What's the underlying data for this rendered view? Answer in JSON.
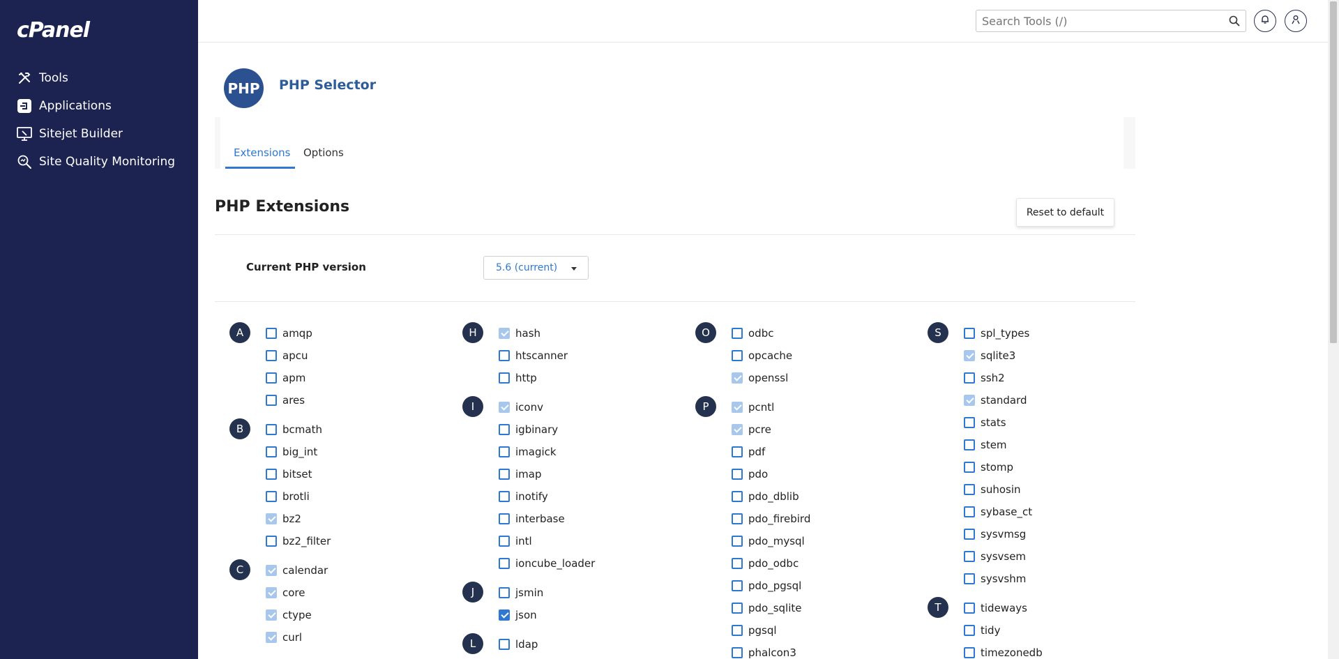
{
  "sidebar": {
    "logo": "cPanel",
    "items": [
      {
        "label": "Tools",
        "icon": "tools-icon"
      },
      {
        "label": "Applications",
        "icon": "applications-icon"
      },
      {
        "label": "Sitejet Builder",
        "icon": "sitejet-builder-icon"
      },
      {
        "label": "Site Quality Monitoring",
        "icon": "site-quality-monitoring-icon"
      }
    ]
  },
  "topbar": {
    "search_placeholder": "Search Tools (/)"
  },
  "header": {
    "logo_text": "PHP",
    "title": "PHP Selector"
  },
  "tabs": [
    {
      "label": "Extensions",
      "active": true
    },
    {
      "label": "Options",
      "active": false
    }
  ],
  "section": {
    "title": "PHP Extensions",
    "reset_label": "Reset to default",
    "version_label": "Current PHP version",
    "version_value": "5.6 (current)"
  },
  "extensions": {
    "columns": [
      {
        "groups": [
          {
            "letter": "A",
            "items": [
              {
                "name": "amqp",
                "checked": false,
                "disabled": false
              },
              {
                "name": "apcu",
                "checked": false,
                "disabled": false
              },
              {
                "name": "apm",
                "checked": false,
                "disabled": false
              },
              {
                "name": "ares",
                "checked": false,
                "disabled": false
              }
            ]
          },
          {
            "letter": "B",
            "items": [
              {
                "name": "bcmath",
                "checked": false,
                "disabled": false
              },
              {
                "name": "big_int",
                "checked": false,
                "disabled": false
              },
              {
                "name": "bitset",
                "checked": false,
                "disabled": false
              },
              {
                "name": "brotli",
                "checked": false,
                "disabled": false
              },
              {
                "name": "bz2",
                "checked": true,
                "disabled": true
              },
              {
                "name": "bz2_filter",
                "checked": false,
                "disabled": false
              }
            ]
          },
          {
            "letter": "C",
            "items": [
              {
                "name": "calendar",
                "checked": true,
                "disabled": true
              },
              {
                "name": "core",
                "checked": true,
                "disabled": true
              },
              {
                "name": "ctype",
                "checked": true,
                "disabled": true
              },
              {
                "name": "curl",
                "checked": true,
                "disabled": true
              }
            ]
          }
        ]
      },
      {
        "groups": [
          {
            "letter": "H",
            "items": [
              {
                "name": "hash",
                "checked": true,
                "disabled": true
              },
              {
                "name": "htscanner",
                "checked": false,
                "disabled": false
              },
              {
                "name": "http",
                "checked": false,
                "disabled": false
              }
            ]
          },
          {
            "letter": "I",
            "items": [
              {
                "name": "iconv",
                "checked": true,
                "disabled": true
              },
              {
                "name": "igbinary",
                "checked": false,
                "disabled": false
              },
              {
                "name": "imagick",
                "checked": false,
                "disabled": false
              },
              {
                "name": "imap",
                "checked": false,
                "disabled": false
              },
              {
                "name": "inotify",
                "checked": false,
                "disabled": false
              },
              {
                "name": "interbase",
                "checked": false,
                "disabled": false
              },
              {
                "name": "intl",
                "checked": false,
                "disabled": false
              },
              {
                "name": "ioncube_loader",
                "checked": false,
                "disabled": false
              }
            ]
          },
          {
            "letter": "J",
            "items": [
              {
                "name": "jsmin",
                "checked": false,
                "disabled": false
              },
              {
                "name": "json",
                "checked": true,
                "disabled": false
              }
            ]
          },
          {
            "letter": "L",
            "items": [
              {
                "name": "ldap",
                "checked": false,
                "disabled": false
              }
            ]
          }
        ]
      },
      {
        "groups": [
          {
            "letter": "O",
            "items": [
              {
                "name": "odbc",
                "checked": false,
                "disabled": false
              },
              {
                "name": "opcache",
                "checked": false,
                "disabled": false
              },
              {
                "name": "openssl",
                "checked": true,
                "disabled": true
              }
            ]
          },
          {
            "letter": "P",
            "items": [
              {
                "name": "pcntl",
                "checked": true,
                "disabled": true
              },
              {
                "name": "pcre",
                "checked": true,
                "disabled": true
              },
              {
                "name": "pdf",
                "checked": false,
                "disabled": false
              },
              {
                "name": "pdo",
                "checked": false,
                "disabled": false
              },
              {
                "name": "pdo_dblib",
                "checked": false,
                "disabled": false
              },
              {
                "name": "pdo_firebird",
                "checked": false,
                "disabled": false
              },
              {
                "name": "pdo_mysql",
                "checked": false,
                "disabled": false
              },
              {
                "name": "pdo_odbc",
                "checked": false,
                "disabled": false
              },
              {
                "name": "pdo_pgsql",
                "checked": false,
                "disabled": false
              },
              {
                "name": "pdo_sqlite",
                "checked": false,
                "disabled": false
              },
              {
                "name": "pgsql",
                "checked": false,
                "disabled": false
              },
              {
                "name": "phalcon3",
                "checked": false,
                "disabled": false
              }
            ]
          }
        ]
      },
      {
        "groups": [
          {
            "letter": "S",
            "items": [
              {
                "name": "spl_types",
                "checked": false,
                "disabled": false
              },
              {
                "name": "sqlite3",
                "checked": true,
                "disabled": true
              },
              {
                "name": "ssh2",
                "checked": false,
                "disabled": false
              },
              {
                "name": "standard",
                "checked": true,
                "disabled": true
              },
              {
                "name": "stats",
                "checked": false,
                "disabled": false
              },
              {
                "name": "stem",
                "checked": false,
                "disabled": false
              },
              {
                "name": "stomp",
                "checked": false,
                "disabled": false
              },
              {
                "name": "suhosin",
                "checked": false,
                "disabled": false
              },
              {
                "name": "sybase_ct",
                "checked": false,
                "disabled": false
              },
              {
                "name": "sysvmsg",
                "checked": false,
                "disabled": false
              },
              {
                "name": "sysvsem",
                "checked": false,
                "disabled": false
              },
              {
                "name": "sysvshm",
                "checked": false,
                "disabled": false
              }
            ]
          },
          {
            "letter": "T",
            "items": [
              {
                "name": "tideways",
                "checked": false,
                "disabled": false
              },
              {
                "name": "tidy",
                "checked": false,
                "disabled": false
              },
              {
                "name": "timezonedb",
                "checked": false,
                "disabled": false
              }
            ]
          }
        ]
      }
    ]
  },
  "colors": {
    "sidebar_bg": "#1d2350",
    "accent": "#2e78d2",
    "title": "#2d5d99",
    "badge": "#24324f"
  }
}
